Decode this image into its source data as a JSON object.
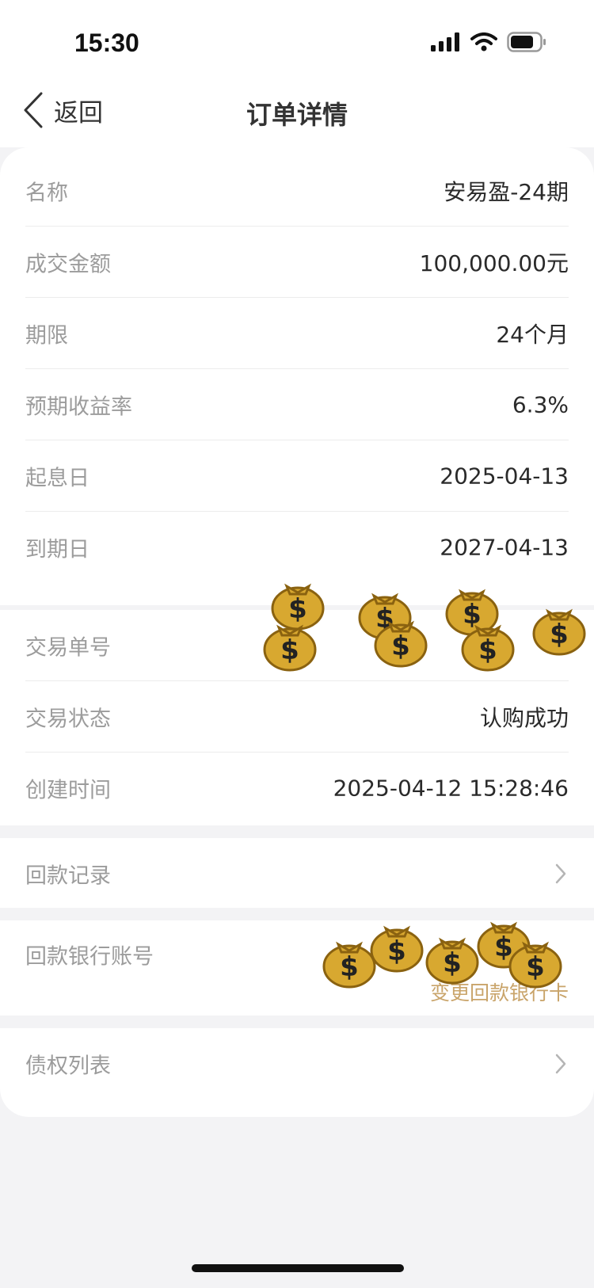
{
  "status_bar": {
    "time": "15:30"
  },
  "nav": {
    "back_label": "返回",
    "title": "订单详情"
  },
  "details": [
    {
      "label": "名称",
      "value": "安易盈-24期"
    },
    {
      "label": "成交金额",
      "value": "100,000.00元"
    },
    {
      "label": "期限",
      "value": "24个月"
    },
    {
      "label": "预期收益率",
      "value": "6.3%"
    },
    {
      "label": "起息日",
      "value": "2025-04-13"
    },
    {
      "label": "到期日",
      "value": "2027-04-13"
    }
  ],
  "transaction": [
    {
      "label": "交易单号",
      "value": ""
    },
    {
      "label": "交易状态",
      "value": "认购成功"
    },
    {
      "label": "创建时间",
      "value": "2025-04-12 15:28:46"
    }
  ],
  "repayment_record": {
    "label": "回款记录"
  },
  "repayment_account": {
    "label": "回款银行账号",
    "link": "变更回款银行卡"
  },
  "debt_list": {
    "label": "债权列表"
  },
  "colors": {
    "accent": "#c9a46a",
    "label": "#9c9c9c",
    "background": "#f3f3f5"
  }
}
